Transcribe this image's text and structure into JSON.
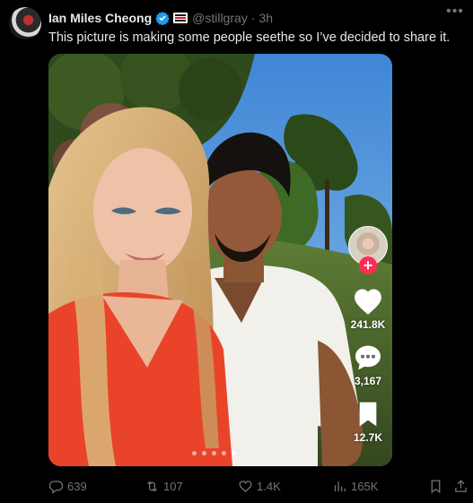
{
  "author": {
    "display_name": "Ian Miles Cheong",
    "handle": "@stillgray",
    "separator": "·",
    "time": "3h"
  },
  "tweet": {
    "text": "This picture is making some people seethe so I’ve decided to share it."
  },
  "media_overlay": {
    "likes": "241.8K",
    "comments": "3,167",
    "saves": "12.7K",
    "carousel_dots": 5,
    "active_dot": 4
  },
  "actions": {
    "replies": "639",
    "reposts": "107",
    "likes": "1.4K",
    "views": "165K"
  },
  "colors": {
    "background": "#000000",
    "text": "#e7e9ea",
    "muted": "#71767b",
    "verified": "#1d9bf0",
    "tiktok_pink": "#fe2c55"
  },
  "icons": [
    "verified-badge-icon",
    "affiliate-flag-icon",
    "more-icon",
    "heart-icon",
    "comment-icon",
    "bookmark-icon",
    "reply-icon",
    "repost-icon",
    "like-icon",
    "views-icon",
    "share-icon"
  ]
}
